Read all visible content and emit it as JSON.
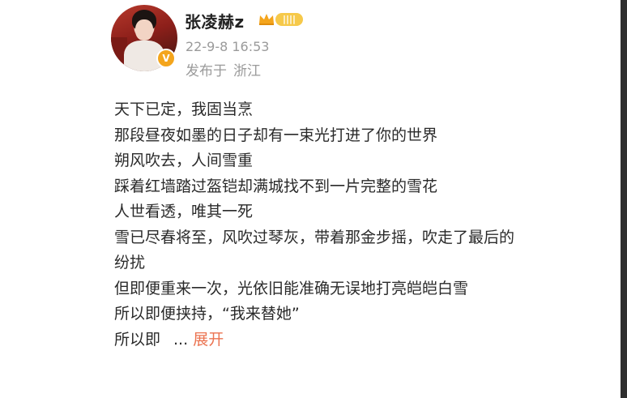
{
  "user": {
    "name": "张凌赫z",
    "verified_badge": "V",
    "level_badge": "||||",
    "crown_icon": "crown-icon",
    "badge_color": "#f4a51c"
  },
  "meta": {
    "timestamp": "22-9-8 16:53",
    "location_prefix": "发布于",
    "location": "浙江"
  },
  "post": {
    "lines": [
      "天下已定，我固当烹",
      "那段昼夜如墨的日子却有一束光打进了你的世界",
      "朔风吹去，人间雪重",
      "踩着红墙踏过盔铠却满城找不到一片完整的雪花",
      "人世看透，唯其一死",
      "雪已尽春将至，风吹过琴灰，带着那金步摇，吹走了最后的",
      "纷扰",
      "但即便重来一次，光依旧能准确无误地打亮皑皑白雪",
      "所以即便挟持，“我来替她”"
    ],
    "last_line_prefix": "所以即",
    "ellipsis": "...",
    "expand_label": "展开",
    "expand_color": "#eb7350"
  }
}
